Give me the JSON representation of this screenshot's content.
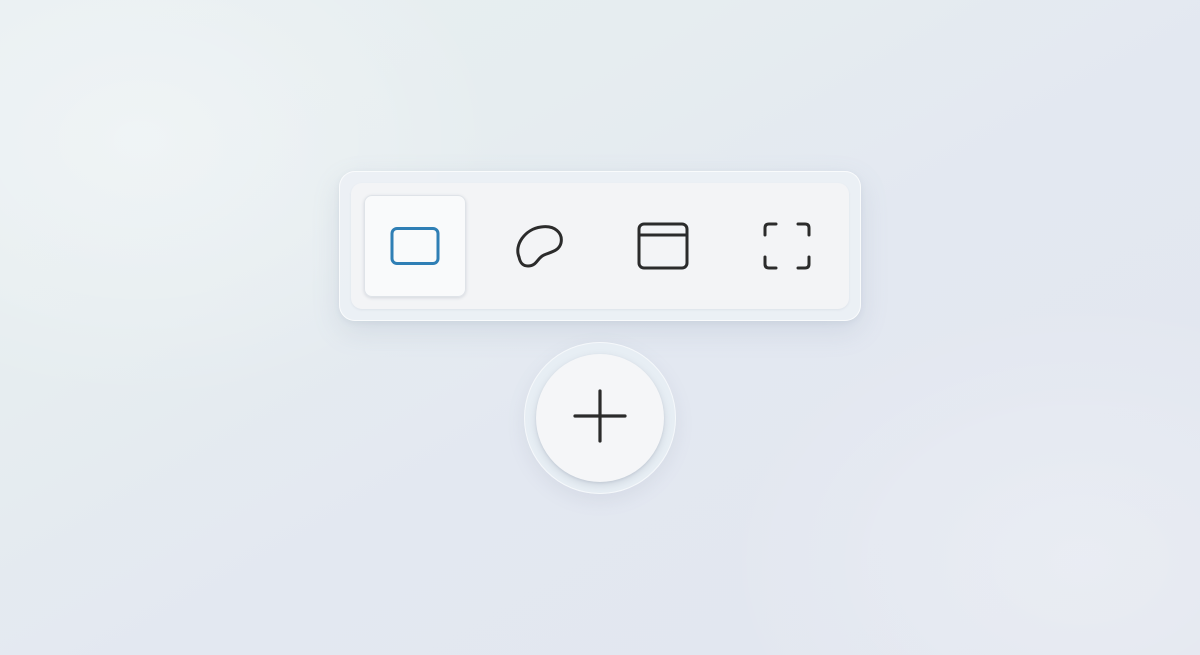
{
  "toolbar": {
    "modes": [
      {
        "id": "rectangle",
        "icon": "rectangle-snip-icon",
        "selected": true,
        "icon_color": "#2f7fb5"
      },
      {
        "id": "freeform",
        "icon": "freeform-snip-icon",
        "selected": false,
        "icon_color": "#2b2b2b"
      },
      {
        "id": "window",
        "icon": "window-snip-icon",
        "selected": false,
        "icon_color": "#2b2b2b"
      },
      {
        "id": "fullscreen",
        "icon": "fullscreen-snip-icon",
        "selected": false,
        "icon_color": "#2b2b2b"
      }
    ]
  },
  "new_button": {
    "icon": "plus-icon",
    "icon_color": "#2b2b2b"
  },
  "colors": {
    "accent": "#2f7fb5",
    "background": "#e5ebf0",
    "surface": "#f3f4f6"
  }
}
